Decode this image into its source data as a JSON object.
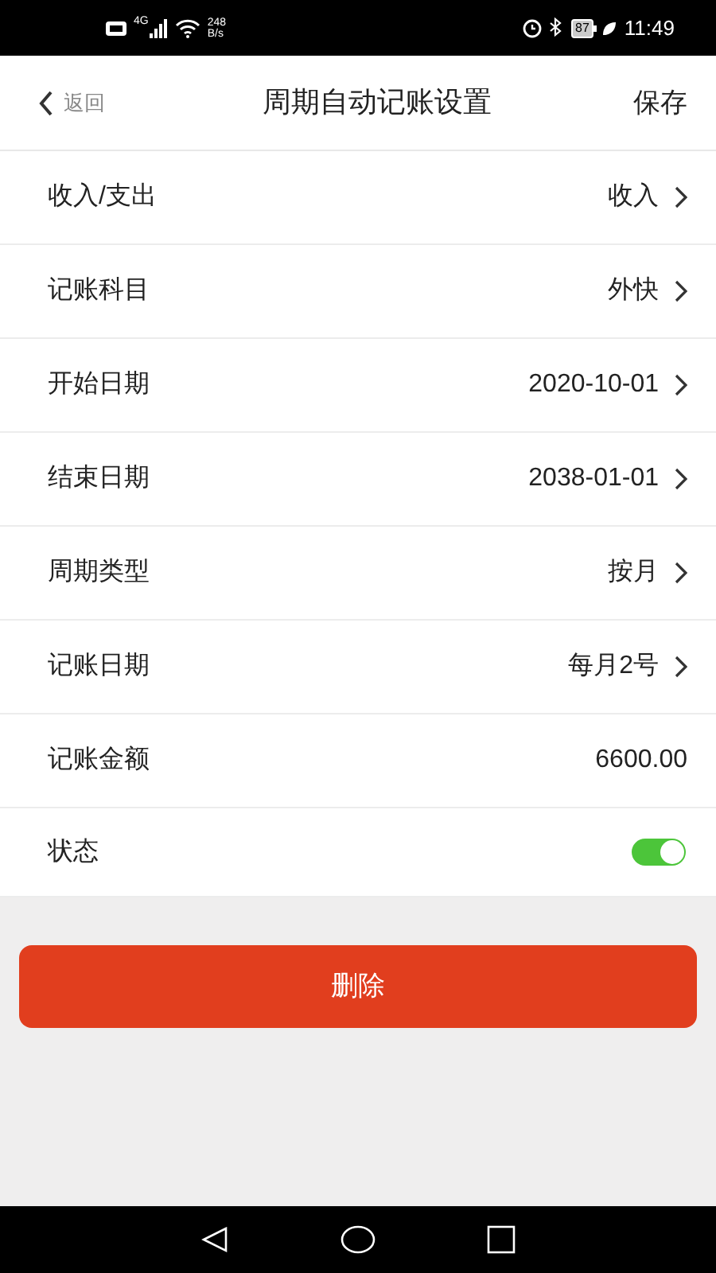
{
  "status_bar": {
    "network": "4G",
    "speed_value": "248",
    "speed_unit": "B/s",
    "battery": "87",
    "time": "11:49"
  },
  "header": {
    "back": "返回",
    "title": "周期自动记账设置",
    "action": "保存"
  },
  "rows": [
    {
      "kind": "nav",
      "label": "收入/支出",
      "value": "收入"
    },
    {
      "kind": "nav",
      "label": "记账科目",
      "value": "外快"
    },
    {
      "kind": "nav",
      "label": "开始日期",
      "value": "2020-10-01"
    },
    {
      "kind": "nav",
      "label": "结束日期",
      "value": "2038-01-01"
    },
    {
      "kind": "nav",
      "label": "周期类型",
      "value": "按月"
    },
    {
      "kind": "nav",
      "label": "记账日期",
      "value": "每月2号"
    },
    {
      "kind": "text",
      "label": "记账金额",
      "value": "6600.00"
    },
    {
      "kind": "toggle",
      "label": "状态",
      "on": true
    }
  ],
  "delete_button": "删除"
}
